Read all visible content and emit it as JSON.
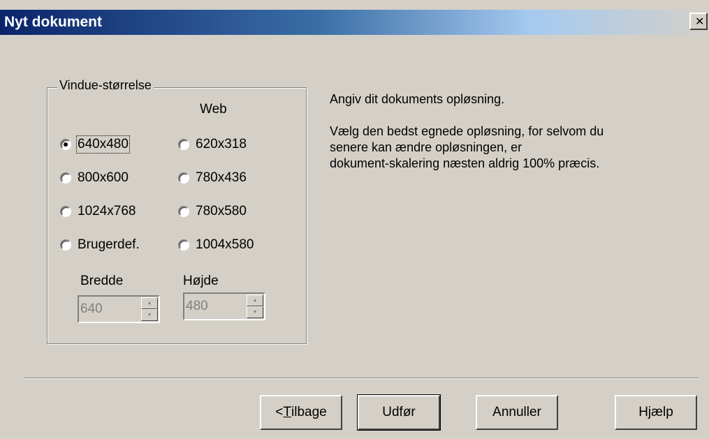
{
  "window": {
    "title": "Nyt dokument",
    "close_glyph": "✕"
  },
  "group": {
    "legend": "Vindue-størrelse",
    "web_label": "Web",
    "options_left": [
      {
        "label": "640x480",
        "selected": true
      },
      {
        "label": "800x600",
        "selected": false
      },
      {
        "label": "1024x768",
        "selected": false
      },
      {
        "label": "Brugerdef.",
        "selected": false
      }
    ],
    "options_right": [
      {
        "label": "620x318",
        "selected": false
      },
      {
        "label": "780x436",
        "selected": false
      },
      {
        "label": "780x580",
        "selected": false
      },
      {
        "label": "1004x580",
        "selected": false
      }
    ],
    "width_label": "Bredde",
    "width_value": "640",
    "height_label": "Højde",
    "height_value": "480"
  },
  "description": {
    "line1": "Angiv dit dokuments opløsning.",
    "line2": "Vælg den bedst egnede opløsning, for selvom du",
    "line3": "senere kan ændre opløsningen, er",
    "line4": "dokument-skalering næsten aldrig 100% præcis."
  },
  "buttons": {
    "back_prefix": "< ",
    "back_underlined": "T",
    "back_rest": "ilbage",
    "finish": "Udfør",
    "cancel": "Annuller",
    "help": "Hjælp"
  },
  "icons": {
    "close": "close-icon",
    "spin_up": "up-arrow-icon",
    "spin_down": "down-arrow-icon"
  }
}
